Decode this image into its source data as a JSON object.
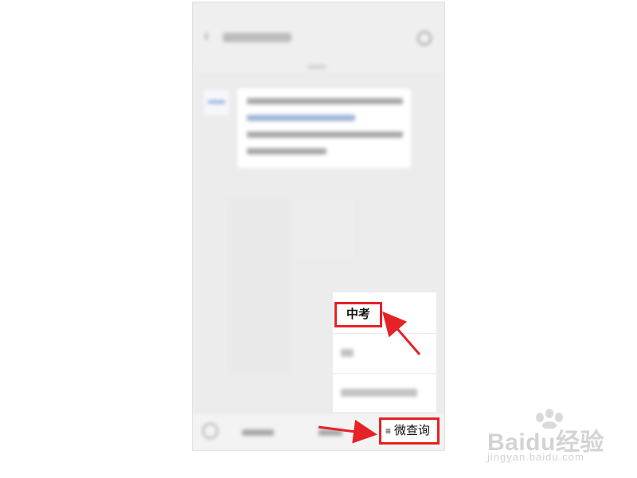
{
  "chat": {
    "title": "",
    "message": ""
  },
  "menu_popup": {
    "first_item": "中考",
    "second_item": "",
    "third_item": ""
  },
  "bottom_bar": {
    "menu_icon": "≡",
    "menu_label": "微查询"
  },
  "annotation": {
    "highlight_color": "#e52226"
  },
  "watermark": {
    "brand": "Baidu经验",
    "url": "jingyan.baidu.com"
  }
}
